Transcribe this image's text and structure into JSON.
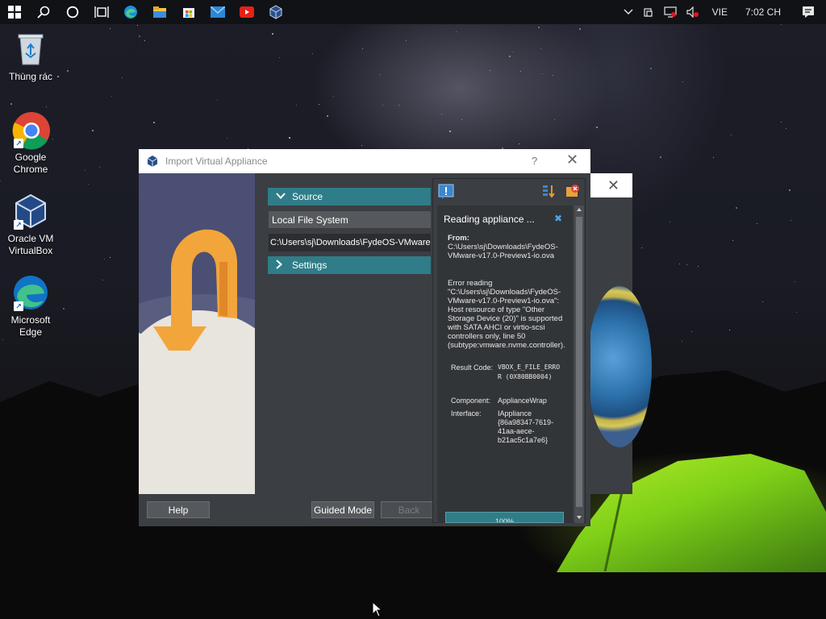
{
  "desktop": {
    "icons": [
      {
        "label": "Thùng rác",
        "icon": "recycle-bin-icon"
      },
      {
        "label": "Google Chrome",
        "icon": "chrome-icon"
      },
      {
        "label": "Oracle VM VirtualBox",
        "icon": "virtualbox-icon"
      },
      {
        "label": "Microsoft Edge",
        "icon": "edge-icon"
      }
    ]
  },
  "taskbar": {
    "icons": [
      "windows-start-icon",
      "search-icon",
      "cortana-icon",
      "task-view-icon",
      "edge-icon",
      "file-explorer-icon",
      "store-icon",
      "mail-icon",
      "youtube-icon",
      "virtualbox-icon"
    ],
    "language": "VIE",
    "time": "7:02 CH"
  },
  "dialog": {
    "title": "Import Virtual Appliance",
    "help_glyph": "?",
    "close_glyph": "✕",
    "source_label": "Source",
    "source_value": "Local File System",
    "file_path": "C:\\Users\\sj\\Downloads\\FydeOS-VMware-v",
    "settings_label": "Settings",
    "buttons": {
      "help": "Help",
      "guided_mode": "Guided Mode",
      "back": "Back"
    }
  },
  "popup": {
    "heading": "Reading appliance ...",
    "from_label": "From:",
    "from_path": " C:\\Users\\sj\\Downloads\\FydeOS-VMware-v17.0-Preview1-io.ova",
    "error_text": "Error reading \"C:\\Users\\sj\\Downloads\\FydeOS-VMware-v17.0-Preview1-io.ova\": Host resource of type \"Other Storage Device (20)\" is supported with SATA AHCI or virtio-scsi controllers only, line 50 (subtype:vmware.nvme.controller).",
    "result_code_label": "Result Code:",
    "result_code_value": "VBOX_E_FILE_ERROR (0X80BB0004)",
    "component_label": "Component:",
    "component_value": "ApplianceWrap",
    "interface_label": "Interface:",
    "interface_value": "IAppliance {86a98347-7619-41aa-aece-b21ac5c1a7e6}",
    "progress_text": "100%",
    "progress_fraction": 1.0
  },
  "colors": {
    "accent_teal": "#2f7d88",
    "dialog_bg": "#3b3e42",
    "taskbar_bg": "#101216"
  }
}
